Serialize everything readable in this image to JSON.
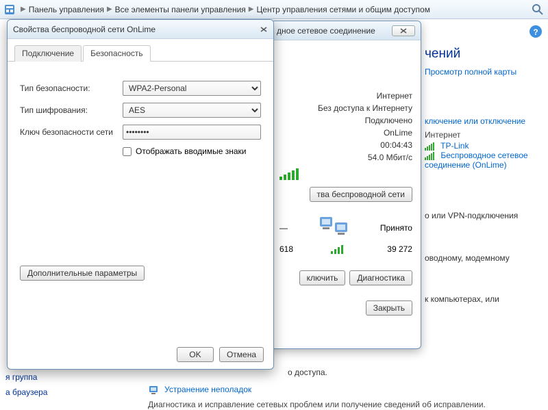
{
  "breadcrumb": {
    "items": [
      "Панель управления",
      "Все элементы панели управления",
      "Центр управления сетями и общим доступом"
    ]
  },
  "bg": {
    "heading": "чений",
    "view_map": "Просмотр полной карты",
    "conn_disc": "ключение или отключение",
    "internet": "Интернет",
    "net1": "TP-Link",
    "net2": "Беспроводное сетевое соединение (OnLime)",
    "vpn_frag": "о или VPN-подключения",
    "modem_frag": "оводному, модемному",
    "comp_frag": "к компьютерах, или",
    "access_frag": "о доступа."
  },
  "left": {
    "group": "я группа",
    "browser": "а браузера"
  },
  "bottom": {
    "fix_link": "Устранение неполадок",
    "fix_desc": "Диагностика и исправление сетевых проблем или получение сведений об исправлении."
  },
  "status": {
    "title": "дное сетевое соединение",
    "rows": {
      "internet": "Интернет",
      "no_access": "Без доступа к Интернету",
      "connected": "Подключено",
      "ssid": "OnLime",
      "duration": "00:04:43",
      "speed": "54.0 Мбит/с"
    },
    "btn_props": "тва беспроводной сети",
    "received": "Принято",
    "sent": "618",
    "recv": "39 272",
    "btn_disc": "ключить",
    "btn_diag": "Диагностика",
    "btn_close": "Закрыть"
  },
  "props": {
    "title": "Свойства беспроводной сети OnLime",
    "tab_conn": "Подключение",
    "tab_sec": "Безопасность",
    "lbl_sec_type": "Тип безопасности:",
    "lbl_enc_type": "Тип шифрования:",
    "lbl_key": "Ключ безопасности сети",
    "val_sec_type": "WPA2-Personal",
    "val_enc_type": "AES",
    "val_key": "••••••••",
    "chk_show": "Отображать вводимые знаки",
    "btn_adv": "Дополнительные параметры",
    "btn_ok": "OK",
    "btn_cancel": "Отмена"
  }
}
